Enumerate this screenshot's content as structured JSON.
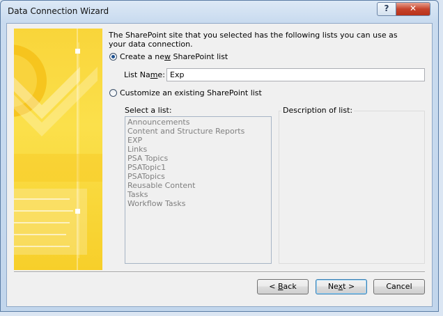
{
  "window": {
    "title": "Data Connection Wizard",
    "help_label": "?",
    "close_label": "✕"
  },
  "intro_text": "The SharePoint site that you selected has the following lists you can use as your data connection.",
  "create_option": {
    "label_pre": "Create a ne",
    "label_key": "w",
    "label_post": " SharePoint list",
    "selected": true
  },
  "list_name": {
    "label_pre": "List Na",
    "label_key": "m",
    "label_post": "e:",
    "value": "Exp"
  },
  "customize_option": {
    "label": "Customize an existing SharePoint list",
    "selected": false
  },
  "select_list_label": "Select a list:",
  "lists": [
    "Announcements",
    "Content and Structure Reports",
    "EXP",
    "Links",
    "PSA Topics",
    "PSATopic1",
    "PSATopics",
    "Reusable Content",
    "Tasks",
    "Workflow Tasks"
  ],
  "description_label": "Description of list:",
  "buttons": {
    "back_pre": "< ",
    "back_key": "B",
    "back_post": "ack",
    "next_pre": "Ne",
    "next_key": "x",
    "next_post": "t >",
    "cancel": "Cancel"
  },
  "colors": {
    "banner": "#f9d53a",
    "banner_accent": "#ffffff",
    "window_frame": "#c2d6ec",
    "close_button": "#c6432b"
  }
}
